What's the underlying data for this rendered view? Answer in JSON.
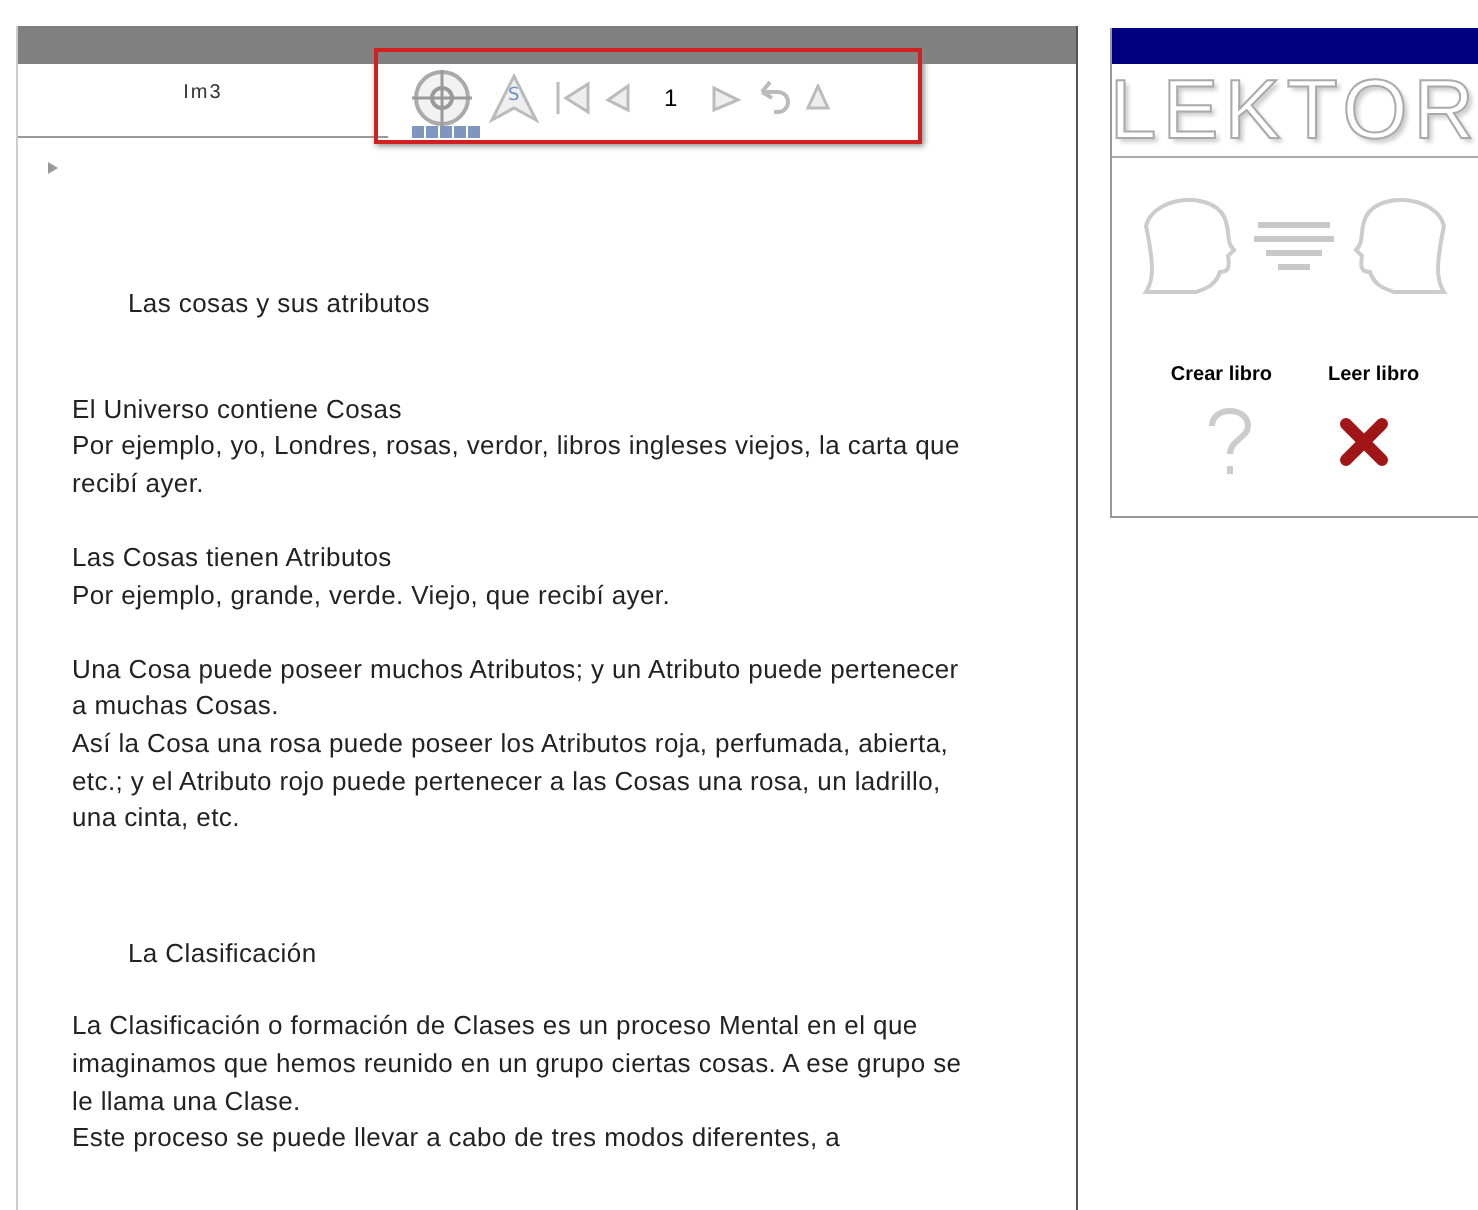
{
  "document": {
    "tab_label": "Im3",
    "nav_icon_letter": "S",
    "page_number": "1",
    "blocks": [
      {
        "kind": "heading",
        "lines": [
          "Las cosas y sus atributos"
        ]
      },
      {
        "kind": "paragraph",
        "lines": [
          "El Universo contiene Cosas",
          "Por ejemplo, yo, Londres, rosas, verdor, libros ingleses viejos, la carta que",
          "recibí ayer."
        ]
      },
      {
        "kind": "paragraph",
        "lines": [
          "Las Cosas tienen Atributos",
          "Por ejemplo, grande, verde. Viejo, que recibí ayer."
        ]
      },
      {
        "kind": "paragraph",
        "lines": [
          "Una Cosa puede poseer muchos Atributos; y un Atributo puede pertenecer",
          "a muchas Cosas.",
          "Así la Cosa una rosa puede poseer los Atributos roja, perfumada, abierta,",
          "etc.; y el  Atributo rojo puede pertenecer a las Cosas una rosa, un ladrillo,",
          "una cinta, etc."
        ]
      },
      {
        "kind": "heading",
        "lines": [
          "La Clasificación"
        ]
      },
      {
        "kind": "paragraph",
        "lines": [
          "La Clasificación o formación de Clases es un proceso Mental en el que",
          "imaginamos que hemos reunido en un grupo ciertas cosas. A ese grupo se",
          "le llama una Clase.",
          "Este proceso se puede llevar a cabo de tres modos diferentes, a"
        ]
      }
    ]
  },
  "side_panel": {
    "logo": "LEKTOR",
    "buttons": [
      {
        "label": "Crear libro"
      },
      {
        "label": "Leer libro"
      }
    ]
  }
}
